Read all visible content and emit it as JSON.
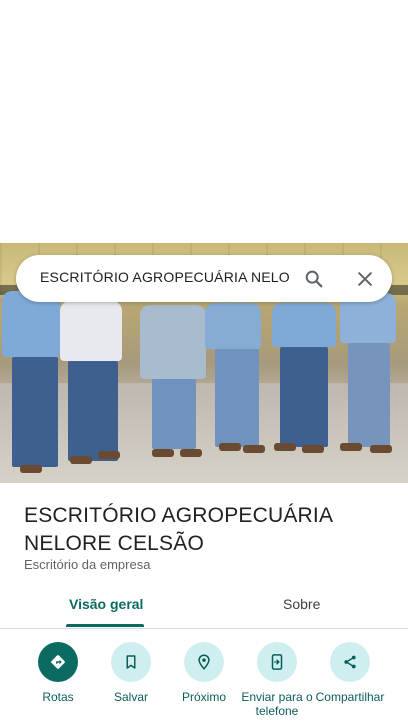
{
  "search": {
    "query": "ESCRITÓRIO AGROPECUÁRIA NELO"
  },
  "place": {
    "title_line1": "ESCRITÓRIO AGROPECUÁRIA",
    "title_line2": "NELORE CELSÃO",
    "type": "Escritório da empresa"
  },
  "tabs": [
    {
      "label": "Visão geral",
      "selected": true
    },
    {
      "label": "Sobre",
      "selected": false
    }
  ],
  "actions": [
    {
      "label": "Rotas",
      "icon": "directions-icon"
    },
    {
      "label": "Salvar",
      "icon": "bookmark-icon"
    },
    {
      "label": "Próximo",
      "icon": "nearby-icon"
    },
    {
      "label": "Enviar para o telefone",
      "icon": "send-to-phone-icon"
    },
    {
      "label": "Compartilhar",
      "icon": "share-icon"
    }
  ],
  "colors": {
    "accent": "#0b6b63",
    "action_bg": "#cfeef0",
    "text": "#202124",
    "muted": "#5f6368"
  }
}
